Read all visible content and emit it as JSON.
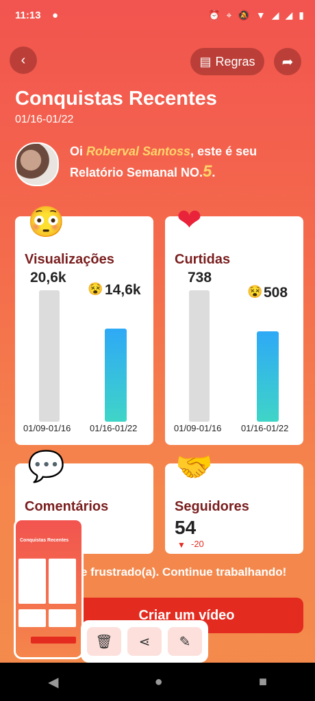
{
  "status": {
    "time": "11:13"
  },
  "header": {
    "rules_label": "Regras",
    "title": "Conquistas Recentes",
    "date_range": "01/16-01/22"
  },
  "greeting": {
    "prefix": "Oi ",
    "name": "Roberval Santoss",
    "middle": ", este é seu",
    "line2": "Relatório Semanal NO.",
    "number": "5",
    "end": "."
  },
  "views": {
    "label": "Visualizações",
    "prev_value": "20,6k",
    "curr_value": "14,6k",
    "prev_date": "01/09-01/16",
    "curr_date": "01/16-01/22",
    "ratio": 0.709
  },
  "likes": {
    "label": "Curtidas",
    "prev_value": "738",
    "curr_value": "508",
    "prev_date": "01/09-01/16",
    "curr_date": "01/16-01/22",
    "ratio": 0.688
  },
  "comments": {
    "label": "Comentários"
  },
  "followers": {
    "label": "Seguidores",
    "value": "54",
    "delta": "-20"
  },
  "encouragement": "e frustrado(a). Continue trabalhando!",
  "cta": {
    "label": "Criar um vídeo"
  },
  "thumbnail": {
    "title": "Conquistas Recentes"
  }
}
